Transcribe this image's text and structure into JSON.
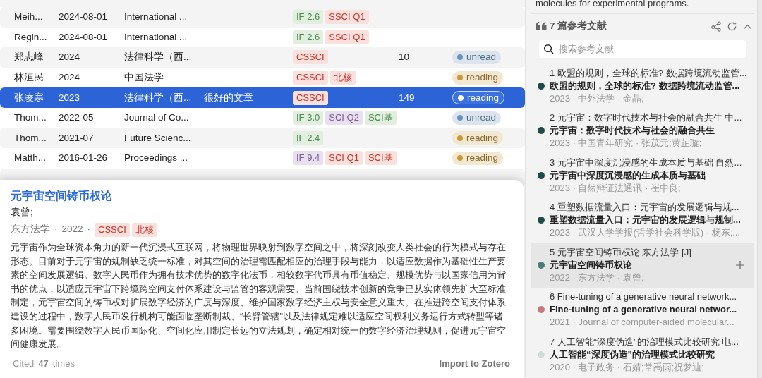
{
  "table": {
    "rows": [
      {
        "author": "Meih...",
        "date": "2024-08-01",
        "journal": "International ...",
        "tags": [
          {
            "text": "IF 2.6",
            "color": "#4a8a4a"
          },
          {
            "text": "SSCI Q1",
            "color": "#c8352b"
          }
        ],
        "selected": false
      },
      {
        "author": "Regin...",
        "date": "2024-08-01",
        "journal": "International ...",
        "tags": [
          {
            "text": "IF 2.6",
            "color": "#4a8a4a"
          },
          {
            "text": "SSCI Q1",
            "color": "#c8352b"
          }
        ],
        "selected": false
      },
      {
        "author": "郑志峰",
        "date": "2024",
        "journal": "法律科学（西...",
        "tags": [
          {
            "text": "CSSCI",
            "color": "#c8352b"
          }
        ],
        "count": "10",
        "status": {
          "kind": "unread",
          "label": "unread"
        },
        "selected": false
      },
      {
        "author": "林洹民",
        "date": "2024",
        "journal": "中国法学",
        "tags": [
          {
            "text": "CSSCI",
            "color": "#c8352b"
          },
          {
            "text": "北核",
            "color": "#c8352b"
          }
        ],
        "status": {
          "kind": "reading",
          "label": "reading"
        },
        "selected": false
      },
      {
        "author": "张凌寒",
        "date": "2023",
        "journal": "法律科学（西...",
        "note": "很好的文章",
        "tags": [
          {
            "text": "CSSCI",
            "color": "#c8352b"
          }
        ],
        "count": "149",
        "status": {
          "kind": "reading",
          "label": "reading"
        },
        "selected": true
      },
      {
        "author": "Thom...",
        "date": "2022-05",
        "journal": "Journal of Co...",
        "tags": [
          {
            "text": "IF 3.0",
            "color": "#4a8a4a"
          },
          {
            "text": "SCI Q2",
            "color": "#7a5a9a"
          },
          {
            "text": "SCI基",
            "color": "#4a8a4a"
          }
        ],
        "status": {
          "kind": "unread",
          "label": "unread"
        },
        "selected": false
      },
      {
        "author": "Thom...",
        "date": "2021-07",
        "journal": "Future Scienc...",
        "tags": [
          {
            "text": "IF 2.4",
            "color": "#4a8a4a"
          }
        ],
        "status": {
          "kind": "reading",
          "label": "reading"
        },
        "selected": false
      },
      {
        "author": "Matth...",
        "date": "2016-01-26",
        "journal": "Proceedings ...",
        "tags": [
          {
            "text": "IF 9.4",
            "color": "#7a5a9a"
          },
          {
            "text": "SCI Q1",
            "color": "#c8352b"
          },
          {
            "text": "SCI基",
            "color": "#c8352b"
          }
        ],
        "status": {
          "kind": "reading",
          "label": "reading"
        },
        "selected": false
      },
      {
        "author": "",
        "date": "",
        "journal": "",
        "tags": [],
        "selected": false
      }
    ]
  },
  "popup": {
    "title": "元宇宙空间铸币权论",
    "authors": "袁曾;",
    "journal": "东方法学",
    "year": "2022",
    "separators": [
      "·",
      "·"
    ],
    "tags": [
      {
        "text": "CSSCI",
        "color": "#c8352b"
      },
      {
        "text": "北核",
        "color": "#c8352b"
      }
    ],
    "abstract": "元宇宙作为全球资本角力的新一代沉浸式互联网，将物理世界映射到数字空间之中，将深刻改变人类社会的行为模式与存在形态。目前对于元宇宙的规制缺乏统一标准，对其空间的治理需匹配相应的治理手段与能力，以适应数据作为基础性生产要素的空间发展逻辑。数字人民币作为拥有技术优势的数字化法币，相较数字代币具有币值稳定、规模优势与以国家信用为背书的优点，以适应元宇宙下跨境跨空间支付体系建设与监管的客观需要。当前围绕技术创新的竞争已从实体领先扩大至标准制定，元宇宙空间的铸币权对扩展数字经济的广度与深度、维护国家数字经济主权与安全意义重大。在推进跨空间支付体系建设的过程中，数字人民币发行机构可能面临垄断制裁、“长臂管辖”以及法律规定难以适应空间权利义务运行方式转型等诸多困境。需要围绕数字人民币国际化、空间化应用制定长远的立法规划，确定相对统一的数字经济治理规则，促进元宇宙空间健康发展。",
    "cited_prefix": "Cited",
    "cited_count": "47",
    "cited_suffix": "times",
    "import_button": "Import to Zotero"
  },
  "sidebar": {
    "top_text": "molecules for experimental programs.",
    "references_title": "7 篇参考文献",
    "search": {
      "placeholder": "搜索参考文献"
    },
    "references": [
      {
        "line": "1 欧盟的规则，全球的标准? 数据跨境流动监管...",
        "title": "欧盟的规则，全球的标准? 数据跨境流动监管...",
        "meta": "2023 · 中外法学 · 金晶;",
        "color": "#1f4a45",
        "selected": false
      },
      {
        "line": "2 元宇宙：数字时代技术与社会的融合共生 中...",
        "title": "元宇宙：数字时代技术与社会的融合共生",
        "meta": "2023 · 中国青年研究 · 张茂元;黄芷璇;",
        "color": "#1f4a45",
        "selected": false
      },
      {
        "line": "3 元宇宙中深度沉浸感的生成本质与基础 自然...",
        "title": "元宇宙中深度沉浸感的生成本质与基础",
        "meta": "2023 · 自然辩证法通讯 · 崔中良;",
        "color": "#1f4a45",
        "selected": false
      },
      {
        "line": "4 重塑数据流量入口：元宇宙的发展逻辑与规...",
        "title": "重塑数据流量入口：元宇宙的发展逻辑与规制...",
        "meta": "2023 · 武汉大学学报(哲学社会科学版) · 杨东;...",
        "color": "#1f4a45",
        "selected": false
      },
      {
        "line": "5 元宇宙空间铸币权论 东方法学 [J]",
        "title": "元宇宙空间铸币权论",
        "meta": "2022 · 东方法学 · 袁曾;",
        "color": "#4f7a78",
        "selected": true
      },
      {
        "line": "6 Fine-tuning of a generative neural network...",
        "title": "Fine-tuning of a generative neural networ...",
        "meta": "2021 · Journal of computer-aided molecular...",
        "color": "#c97b7b",
        "selected": false
      },
      {
        "line": "7 人工智能“深度伪造”的治理模式比较研究 电...",
        "title": "人工智能“深度伪造”的治理模式比较研究",
        "meta": "2020 · 电子政务 · 石婧;常禹雨;祝梦迪;",
        "color": "#cfdcdc",
        "selected": false
      }
    ]
  }
}
